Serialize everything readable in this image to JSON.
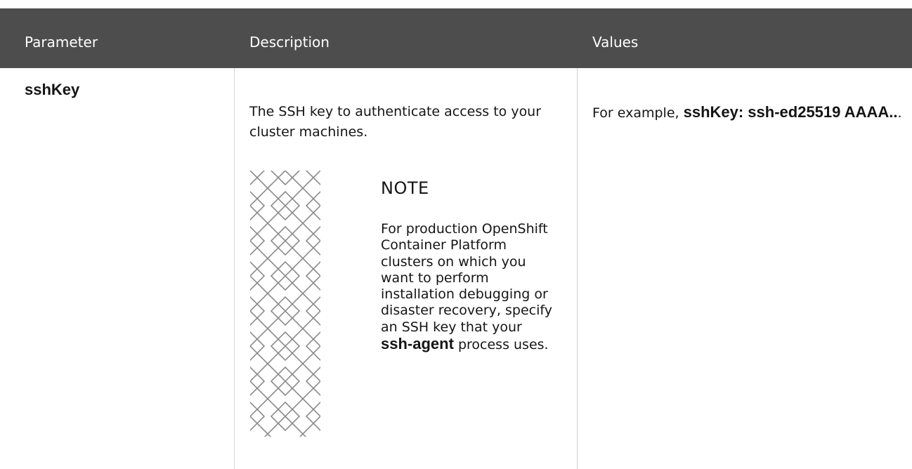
{
  "header": {
    "parameter": "Parameter",
    "description": "Description",
    "values": "Values"
  },
  "row": {
    "parameter": "sshKey",
    "description": "The SSH key to authenticate access to your cluster machines.",
    "values_prefix": "For example, ",
    "values_code": "sshKey: ssh-ed25519 AAAA..",
    "values_suffix": "."
  },
  "note": {
    "title": "NOTE",
    "body_before": "For production OpenShift Container Platform clusters on which you want to perform installation debugging or disaster recovery, specify an SSH key that your ",
    "body_code": "ssh-agent",
    "body_after": " process uses."
  }
}
